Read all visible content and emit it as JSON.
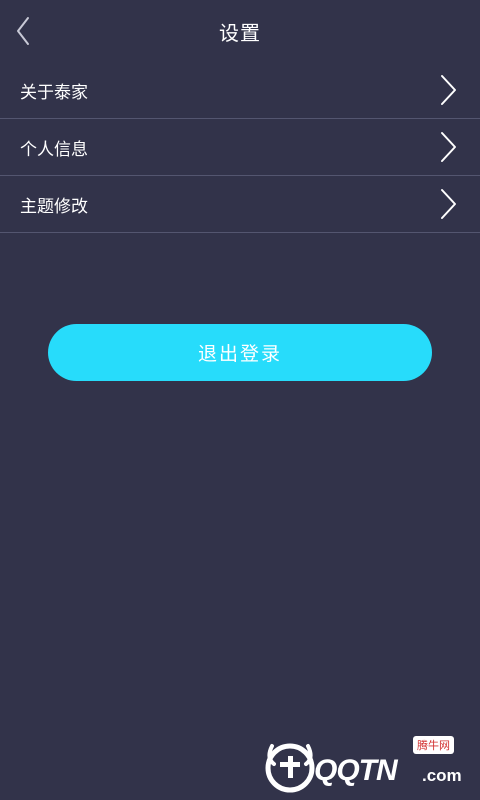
{
  "header": {
    "title": "设置",
    "back_icon": "chevron-left-icon"
  },
  "menu": {
    "items": [
      {
        "label": "关于泰家",
        "icon": "chevron-right-icon"
      },
      {
        "label": "个人信息",
        "icon": "chevron-right-icon"
      },
      {
        "label": "主题修改",
        "icon": "chevron-right-icon"
      }
    ]
  },
  "logout": {
    "label": "退出登录"
  },
  "watermark": {
    "brand": "QQTN",
    "domain": ".com",
    "badge": "腾牛网"
  },
  "colors": {
    "background": "#32334a",
    "divider": "#545670",
    "accent": "#27dcfb",
    "text": "#ffffff"
  }
}
